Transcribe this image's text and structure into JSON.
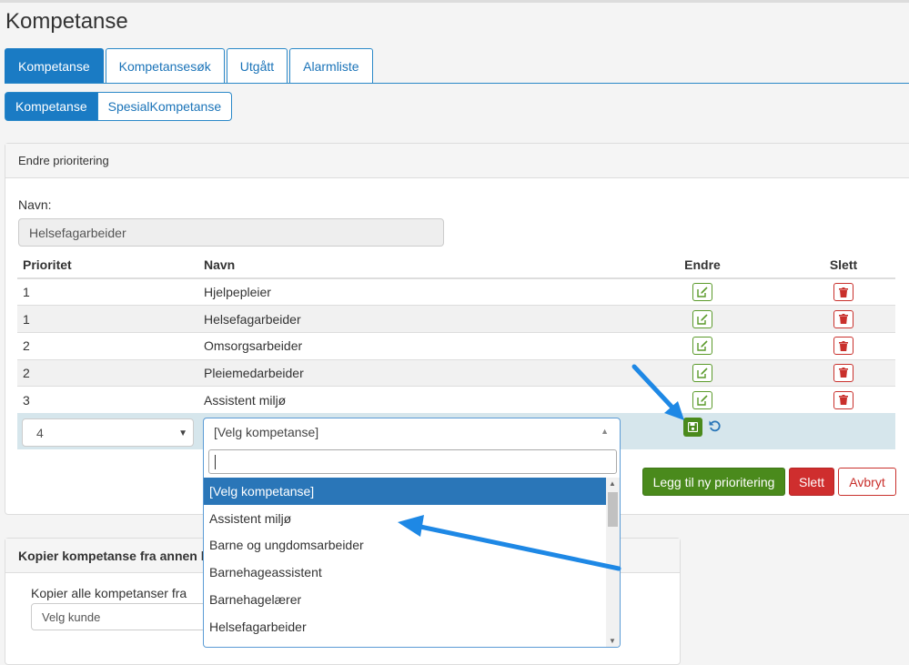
{
  "page": {
    "title": "Kompetanse"
  },
  "tabs": [
    {
      "label": "Kompetanse",
      "active": true
    },
    {
      "label": "Kompetansesøk",
      "active": false
    },
    {
      "label": "Utgått",
      "active": false
    },
    {
      "label": "Alarmliste",
      "active": false
    }
  ],
  "subtabs": [
    {
      "label": "Kompetanse",
      "active": true
    },
    {
      "label": "SpesialKompetanse",
      "active": false
    }
  ],
  "panel": {
    "heading": "Endre prioritering",
    "name_label": "Navn:",
    "name_value": "Helsefagarbeider"
  },
  "table": {
    "headers": {
      "priority": "Prioritet",
      "name": "Navn",
      "edit": "Endre",
      "delete": "Slett"
    },
    "rows": [
      {
        "priority": "1",
        "name": "Hjelpepleier"
      },
      {
        "priority": "1",
        "name": "Helsefagarbeider"
      },
      {
        "priority": "2",
        "name": "Omsorgsarbeider"
      },
      {
        "priority": "2",
        "name": "Pleiemedarbeider"
      },
      {
        "priority": "3",
        "name": "Assistent miljø"
      }
    ]
  },
  "edit_row": {
    "priority_value": "4",
    "competence_value": "[Velg kompetanse]"
  },
  "dropdown": {
    "search_value": "",
    "options": [
      {
        "label": "[Velg kompetanse]",
        "selected": true
      },
      {
        "label": "Assistent miljø",
        "selected": false
      },
      {
        "label": "Barne og ungdomsarbeider",
        "selected": false
      },
      {
        "label": "Barnehageassistent",
        "selected": false
      },
      {
        "label": "Barnehagelærer",
        "selected": false
      },
      {
        "label": "Helsefagarbeider",
        "selected": false
      }
    ]
  },
  "buttons": {
    "add": "Legg til ny prioritering",
    "delete": "Slett",
    "cancel": "Avbryt"
  },
  "copy_panel": {
    "heading": "Kopier kompetanse fra annen k",
    "label": "Kopier alle kompetanser fra",
    "select_value": "Velg kunde"
  },
  "colors": {
    "primary": "#1a7bc4",
    "success": "#4a8a1c",
    "danger": "#cf2e2e",
    "annotation_arrow": "#1e88e5"
  },
  "icons": {
    "edit": "edit-icon",
    "delete": "trash-icon",
    "save": "save-icon",
    "undo": "undo-icon"
  }
}
